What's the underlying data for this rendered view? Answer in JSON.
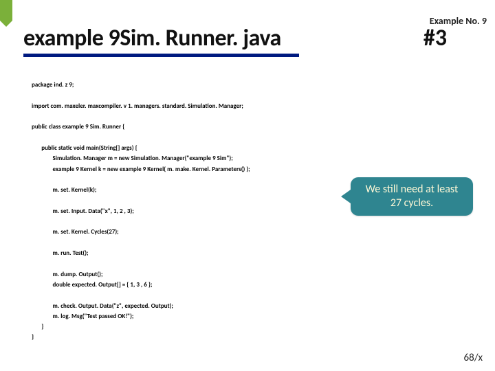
{
  "meta": {
    "example_no": "Example No. 9",
    "page_num": "68/x"
  },
  "title": {
    "main": "example 9Sim. Runner. java",
    "hash": "#3"
  },
  "callout": {
    "text": "We still need at least 27 cycles."
  },
  "code": {
    "l01": "package ind. z 9;",
    "l02": "import com. maxeler. maxcompiler. v 1. managers. standard. Simulation. Manager;",
    "l03": "public class example 9 Sim. Runner {",
    "l04": "       public static void main(String[] args) {",
    "l05": "               Simulation. Manager m = new Simulation. Manager(\"example 9 Sim\");",
    "l06": "               example 9 Kernel k = new example 9 Kernel( m. make. Kernel. Parameters() );",
    "l07": "               m. set. Kernel(k);",
    "l08": "               m. set. Input. Data(\"x\", 1, 2 , 3);",
    "l09": "               m. set. Kernel. Cycles(27);",
    "l10": "               m. run. Test();",
    "l11": "               m. dump. Output();",
    "l12": "               double expected. Output[] = { 1, 3 , 6 };",
    "l13": "               m. check. Output. Data(\"z\", expected. Output);",
    "l14": "               m. log. Msg(\"Test passed OK!\");",
    "l15": "       }",
    "l16": "}"
  }
}
